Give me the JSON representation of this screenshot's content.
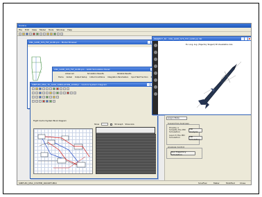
{
  "app": {
    "title": "Sindica"
  },
  "menu": [
    "File",
    "Edit",
    "View",
    "Model",
    "Tools",
    "Window",
    "Help"
  ],
  "status": {
    "left": "SIMFLEX_MSC_SYSTEM_ROCKET.PRO",
    "right": [
      "SinuFlex",
      "Meter",
      "Modified",
      "Close"
    ]
  },
  "windows": {
    "back": {
      "title": "CNL_GUID_SYS_FLT_GUID.pro - Model Browser"
    },
    "tabs": {
      "title": "CNL_GUID_SYS_FLT_GUID.pro - GUID Simulation Panel",
      "tabs": [
        "Home",
        "Advanced",
        "Analysis",
        "Simulation Results",
        "Variable Results",
        "Report"
      ],
      "subtabs": [
        "Global",
        "Output Setup",
        "Initial Conditions",
        "Integration Parameters",
        "Input Test Function",
        "Results"
      ]
    },
    "diagram": {
      "title": "SIMFLEX_MSC_TC_GUID_SIMULATION_LOOP.pr - Control System Diagram",
      "label": "Flight Control System Block Diagram",
      "show_label": "Show",
      "chk1": "3D Graph",
      "chk2": "Show Axis"
    },
    "view3d": {
      "title": "PROJECT_30 - CNL_GUID_SYS_FLT_GUID.prj 3D",
      "caption": "Ex. Long. Ang. (Trajectory Tangent) 3D Visualization Axis"
    }
  },
  "panel": {
    "row1": "Long Ini Mode",
    "group1": "Supporting Analyses",
    "text1": "Display a Simplify the PID Simulation",
    "btn1": "PID Analysis",
    "text2": "Launch the PID Simulation",
    "btn2": "PID Simulation",
    "group2": "Analysis Control",
    "btn3": "Run Trajectory Simulation"
  }
}
